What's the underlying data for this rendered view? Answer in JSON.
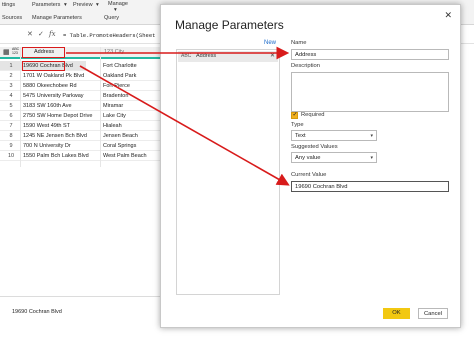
{
  "ribbon": {
    "tab_settings": "ttings",
    "tab_parameters": "Parameters",
    "tab_parameters_arrow": "▾",
    "tab_preview": "Preview",
    "tab_preview_arrow": "▾",
    "tab_manage": "Manage",
    "tab_manage_arrow": "▾",
    "group_sources": "Sources",
    "group_manage_params": "Manage Parameters",
    "group_query": "Query"
  },
  "formula_bar": {
    "cancel_glyph": "✕",
    "accept_glyph": "✓",
    "fx_label": "fx",
    "formula_text": "= Table.PromoteHeaders(Sheet"
  },
  "table": {
    "col1_type_glyph": "ABC\n123",
    "col1_header": "Address",
    "col2_header": "123 City",
    "rows": [
      {
        "n": "1",
        "address": "19690 Cochran Blvd",
        "city": "Fort Charlotte"
      },
      {
        "n": "2",
        "address": "1701 W Oakland Pk Blvd",
        "city": "Oakland Park"
      },
      {
        "n": "3",
        "address": "5880 Okeechobee Rd",
        "city": "Fort Pierce"
      },
      {
        "n": "4",
        "address": "5475 University Parkway",
        "city": "Bradenton"
      },
      {
        "n": "5",
        "address": "3183 SW 160th Ave",
        "city": "Miramar"
      },
      {
        "n": "6",
        "address": "2750 SW Home Depot Drive",
        "city": "Lake City"
      },
      {
        "n": "7",
        "address": "1590 West 49th ST",
        "city": "Hialeah"
      },
      {
        "n": "8",
        "address": "1245 NE Jensen Bch Blvd",
        "city": "Jensen Beach"
      },
      {
        "n": "9",
        "address": "700 N University Dr",
        "city": "Coral Springs"
      },
      {
        "n": "10",
        "address": "1550 Palm Bch Lakes Blvd",
        "city": "West Palm Beach"
      }
    ]
  },
  "preview_value": "19690 Cochran Blvd",
  "dialog": {
    "title": "Manage Parameters",
    "close_glyph": "✕",
    "new_link": "New",
    "param_icon": "ABC",
    "param_name": "Address",
    "param_remove_glyph": "✕",
    "name_label": "Name",
    "name_value": "Address",
    "description_label": "Description",
    "description_value": "",
    "required_label": "Required",
    "required_checked": true,
    "check_glyph": "✓",
    "type_label": "Type",
    "type_value": "Text",
    "dropdown_arrow": "▾",
    "suggested_label": "Suggested Values",
    "suggested_value": "Any value",
    "current_label": "Current Value",
    "current_value": "19690 Cochran Blvd",
    "ok_label": "OK",
    "cancel_label": "Cancel"
  },
  "colors": {
    "annotation_red": "#d81b1b",
    "ok_yellow": "#f2c811",
    "header_teal": "#22b8a2",
    "link_blue": "#1b6ac9"
  }
}
